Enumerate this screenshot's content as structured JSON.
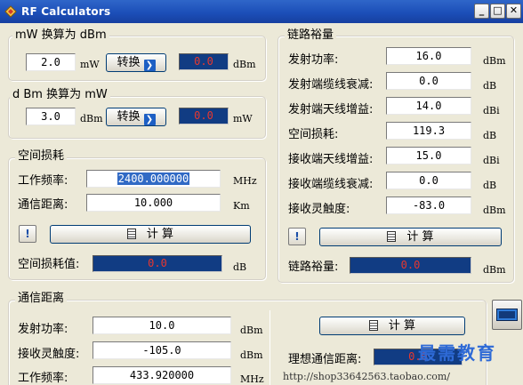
{
  "window": {
    "title": "RF Calculators",
    "minimize": "_",
    "maximize": "□",
    "close": "✕"
  },
  "mw_to_dbm": {
    "title": "mW 换算为 dBm",
    "input": "2.0",
    "input_unit": "mW",
    "button": "转换",
    "output": "0.0",
    "output_unit": "dBm"
  },
  "dbm_to_mw": {
    "title": "d Bm 换算为 mW",
    "input": "3.0",
    "input_unit": "dBm",
    "button": "转换",
    "output": "0.0",
    "output_unit": "mW"
  },
  "space_loss": {
    "title": "空间损耗",
    "freq_label": "工作频率:",
    "freq_value": "2400.000000",
    "freq_unit": "MHz",
    "dist_label": "通信距离:",
    "dist_value": "10.000",
    "dist_unit": "Km",
    "help_glyph": "!",
    "calc_button": "计  算",
    "result_label": "空间损耗值:",
    "result_value": "0.0",
    "result_unit": "dB"
  },
  "link_margin": {
    "title": "链路裕量",
    "rows": [
      {
        "label": "发射功率:",
        "value": "16.0",
        "unit": "dBm"
      },
      {
        "label": "发射端缆线衰减:",
        "value": "0.0",
        "unit": "dB"
      },
      {
        "label": "发射端天线增益:",
        "value": "14.0",
        "unit": "dBi"
      },
      {
        "label": "空间损耗:",
        "value": "119.3",
        "unit": "dB"
      },
      {
        "label": "接收端天线增益:",
        "value": "15.0",
        "unit": "dBi"
      },
      {
        "label": "接收端缆线衰减:",
        "value": "0.0",
        "unit": "dB"
      },
      {
        "label": "接收灵触度:",
        "value": "-83.0",
        "unit": "dBm"
      }
    ],
    "help_glyph": "!",
    "calc_button": "计  算",
    "result_label": "链路裕量:",
    "result_value": "0.0",
    "result_unit": "dBm"
  },
  "comm_distance": {
    "title": "通信距离",
    "rows": [
      {
        "label": "发射功率:",
        "value": "10.0",
        "unit": "dBm"
      },
      {
        "label": "接收灵触度:",
        "value": "-105.0",
        "unit": "dBm"
      },
      {
        "label": "工作频率:",
        "value": "433.920000",
        "unit": "MHz"
      }
    ],
    "calc_button": "计  算",
    "result_label": "理想通信距离:",
    "result_value": "0.0"
  },
  "watermark": {
    "text": "最需教育",
    "url": "http://shop33642563.taobao.com/"
  },
  "colors": {
    "output_bg": "#113c83",
    "output_text": "#e8372e",
    "titlebar": "#1c4fb8",
    "window_bg": "#ece9d8"
  }
}
